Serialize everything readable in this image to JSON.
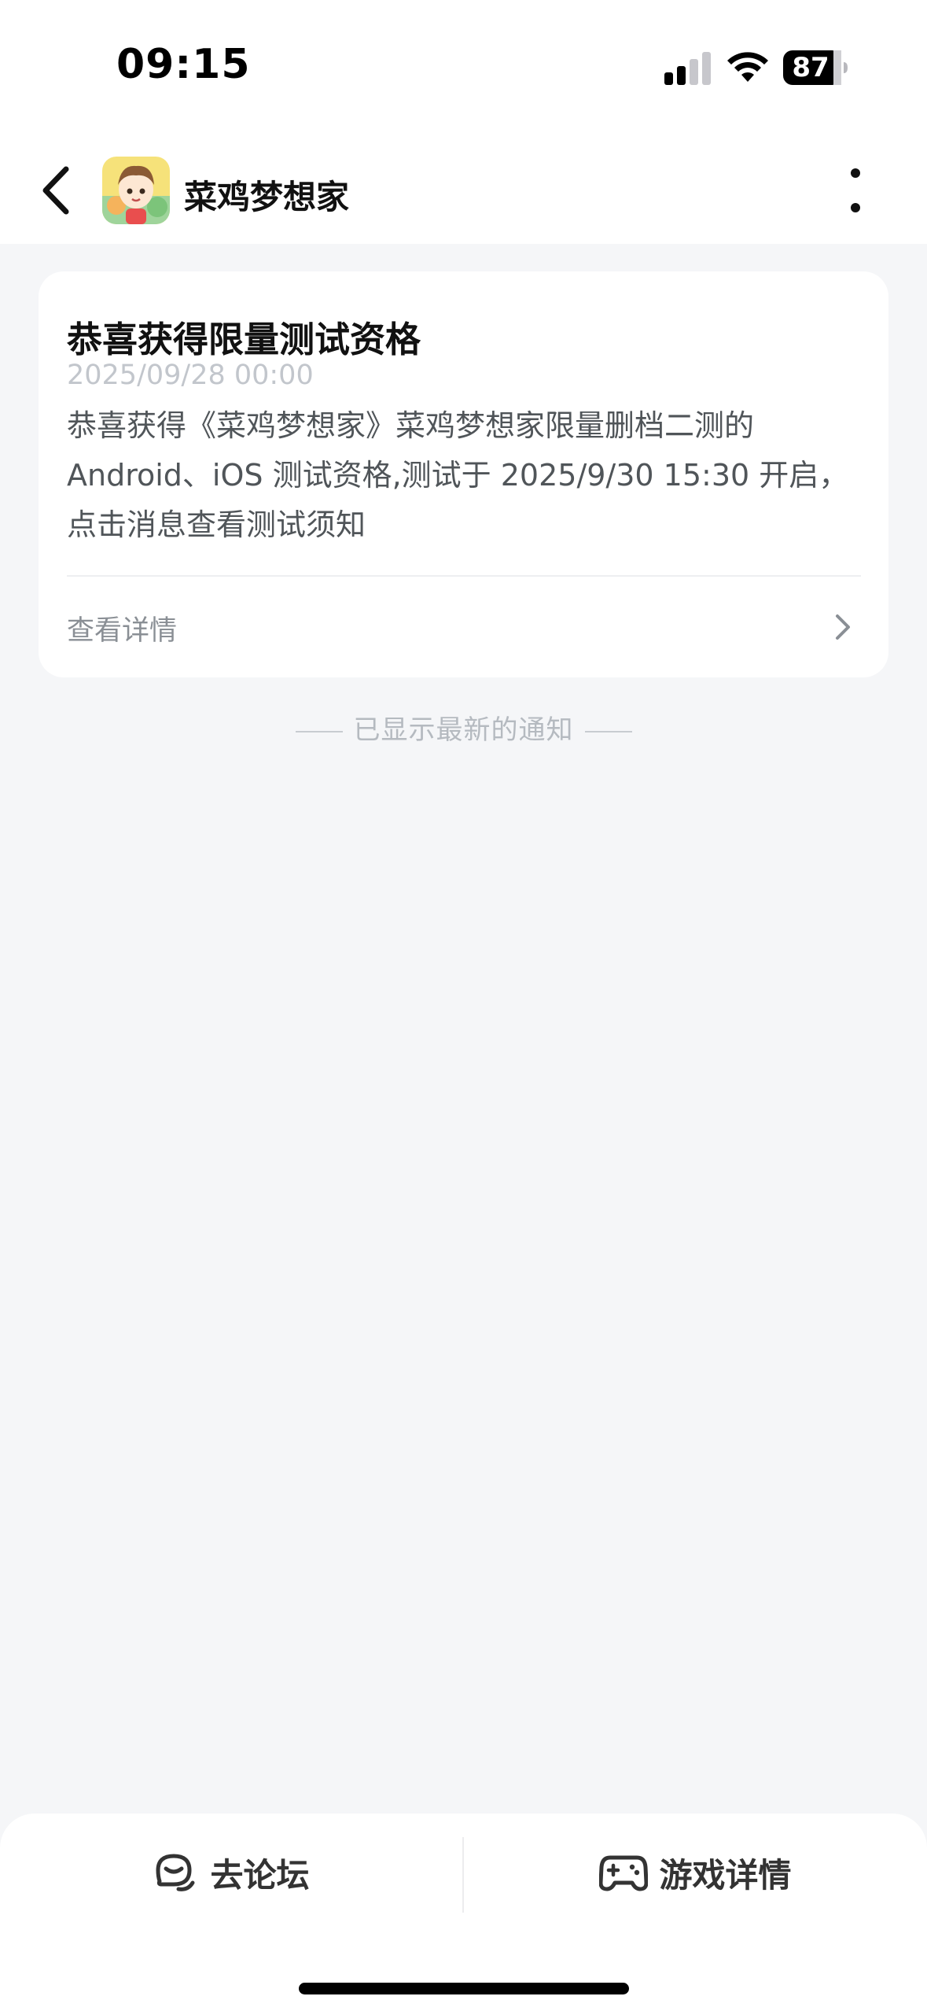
{
  "status_bar": {
    "time": "09:15",
    "battery": "87",
    "icons": [
      "signal-icon",
      "wifi-icon",
      "battery-icon"
    ]
  },
  "nav": {
    "title": "菜鸡梦想家",
    "icons": [
      "back-chevron-icon",
      "app-avatar",
      "more-vertical-icon"
    ]
  },
  "notification": {
    "title": "恭喜获得限量测试资格",
    "timestamp": "2025/09/28 00:00",
    "body": "恭喜获得《菜鸡梦想家》菜鸡梦想家限量删档二测的 Android、iOS 测试资格,测试于 2025/9/30 15:30 开启，点击消息查看测试须知",
    "link_label": "查看详情"
  },
  "end_notice": "已显示最新的通知",
  "bottom_bar": {
    "forum_label": "去论坛",
    "game_label": "游戏详情"
  },
  "colors": {
    "background": "#f5f6f8",
    "card": "#ffffff",
    "muted_text": "#8a8f95",
    "timestamp": "#c2c6cc"
  }
}
